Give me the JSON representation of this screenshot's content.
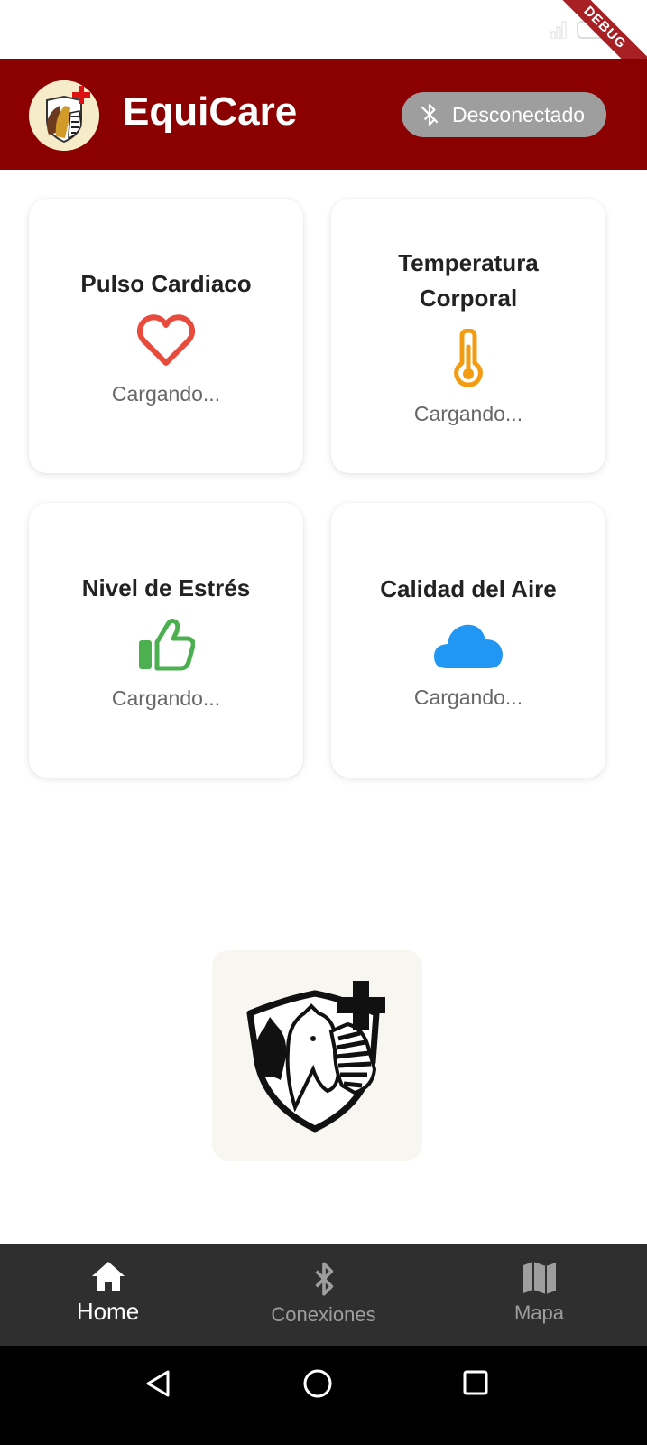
{
  "app": {
    "title": "EquiCare"
  },
  "status_bar": {
    "battery": "20",
    "debug_banner": "DEBUG"
  },
  "connection": {
    "status_label": "Desconectado",
    "status_color": "#9e9e9e"
  },
  "theme": {
    "primary": "#8b0000",
    "heart": "#e84a3c",
    "thermo": "#f39c12",
    "stress": "#4caf50",
    "air": "#2196f3"
  },
  "cards": [
    {
      "title": "Pulso Cardiaco",
      "icon": "heart-icon",
      "value": "Cargando..."
    },
    {
      "title": "Temperatura Corporal",
      "icon": "thermometer-icon",
      "value": "Cargando..."
    },
    {
      "title": "Nivel de Estrés",
      "icon": "thumbs-up-icon",
      "value": "Cargando..."
    },
    {
      "title": "Calidad del Aire",
      "icon": "cloud-icon",
      "value": "Cargando..."
    }
  ],
  "bottom_nav": [
    {
      "label": "Home",
      "icon": "home-icon",
      "active": true
    },
    {
      "label": "Conexiones",
      "icon": "bluetooth-icon",
      "active": false
    },
    {
      "label": "Mapa",
      "icon": "map-icon",
      "active": false
    }
  ],
  "system_nav": [
    "back-icon",
    "home-circle-icon",
    "recents-icon"
  ]
}
